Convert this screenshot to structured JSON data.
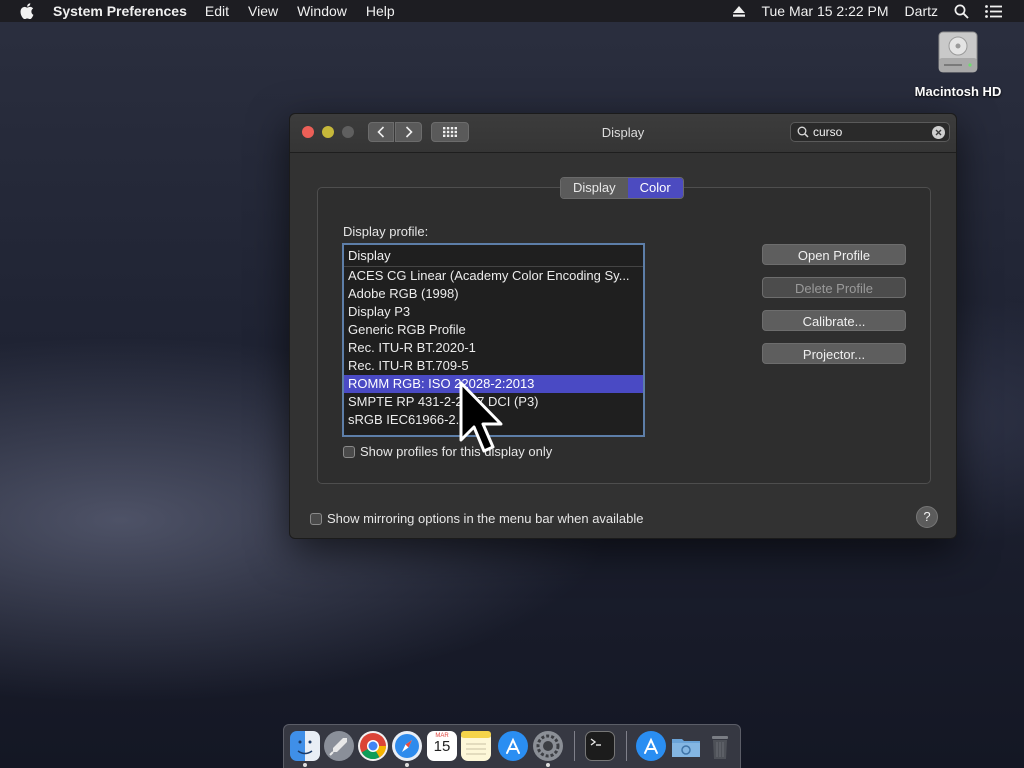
{
  "menubar": {
    "app_name": "System Preferences",
    "items": [
      "Edit",
      "View",
      "Window",
      "Help"
    ],
    "clock": "Tue Mar 15  2:22 PM",
    "user": "Dartz",
    "icons": [
      "apple-icon",
      "eject-icon",
      "spotlight-search-icon",
      "notification-center-icon"
    ]
  },
  "desktop": {
    "hd_label": "Macintosh HD"
  },
  "window": {
    "title": "Display",
    "search_value": "curso",
    "tabs": [
      {
        "label": "Display",
        "active": false
      },
      {
        "label": "Color",
        "active": true
      }
    ],
    "profile_label": "Display profile:",
    "list_header": "Display",
    "profiles": [
      "ACES CG Linear (Academy Color Encoding Sy...",
      "Adobe RGB (1998)",
      "Display P3",
      "Generic RGB Profile",
      "Rec. ITU-R BT.2020-1",
      "Rec. ITU-R BT.709-5",
      "ROMM RGB: ISO 22028-2:2013",
      "SMPTE RP 431-2-2007 DCI (P3)",
      "sRGB IEC61966-2.1"
    ],
    "selected_profile": "ROMM RGB: ISO 22028-2:2013",
    "buttons": {
      "open": "Open Profile",
      "delete": "Delete Profile",
      "calibrate": "Calibrate...",
      "projector": "Projector..."
    },
    "show_profiles_label": "Show profiles for this display only",
    "mirroring_label": "Show mirroring options in the menu bar when available",
    "help_label": "?"
  },
  "dock": {
    "calendar_month": "MAR",
    "calendar_day": "15",
    "apps": [
      "Finder",
      "Launchpad",
      "Chrome",
      "Safari",
      "Calendar",
      "Notes",
      "App Store",
      "System Preferences",
      "Terminal",
      "App Store",
      "Downloads",
      "Trash"
    ]
  },
  "colors": {
    "accent": "#4a4ac4",
    "close": "#ec5f57",
    "minimize": "#c6b83a"
  }
}
